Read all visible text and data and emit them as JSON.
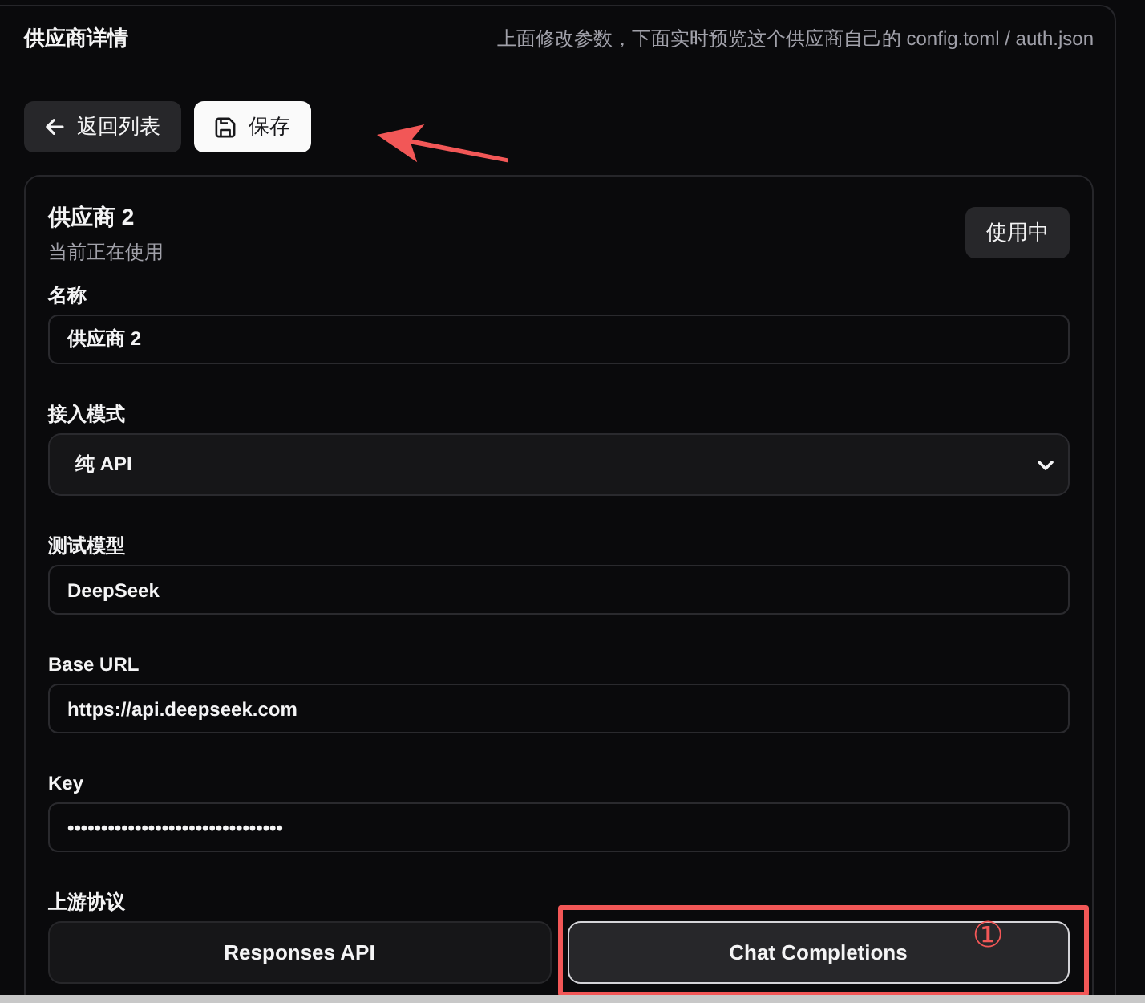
{
  "panel": {
    "title": "供应商详情",
    "hint": "上面修改参数，下面实时预览这个供应商自己的 config.toml / auth.json"
  },
  "toolbar": {
    "buttons": [
      {
        "kind": "back",
        "label": "返回列表",
        "annotation_arrow": false
      },
      {
        "kind": "save",
        "label": "保存",
        "annotation_arrow": true
      }
    ]
  },
  "provider": {
    "name": "供应商 2",
    "status": "当前正在使用",
    "badge": "使用中",
    "fields": [
      {
        "kind": "text",
        "label": "名称",
        "value": "供应商 2"
      },
      {
        "kind": "select",
        "label": "接入模式",
        "value": "纯 API"
      },
      {
        "kind": "text",
        "label": "测试模型",
        "value": "DeepSeek"
      },
      {
        "kind": "text",
        "label": "Base URL",
        "value": "https://api.deepseek.com"
      },
      {
        "kind": "text",
        "label": "Key",
        "value": "••••••••••••••••••••••••••••••••"
      }
    ],
    "protocol": {
      "label": "上游协议",
      "options": [
        {
          "label": "Responses API",
          "selected": false,
          "highlighted": false
        },
        {
          "label": "Chat Completions",
          "selected": true,
          "highlighted": true,
          "callout": "①"
        }
      ]
    }
  }
}
